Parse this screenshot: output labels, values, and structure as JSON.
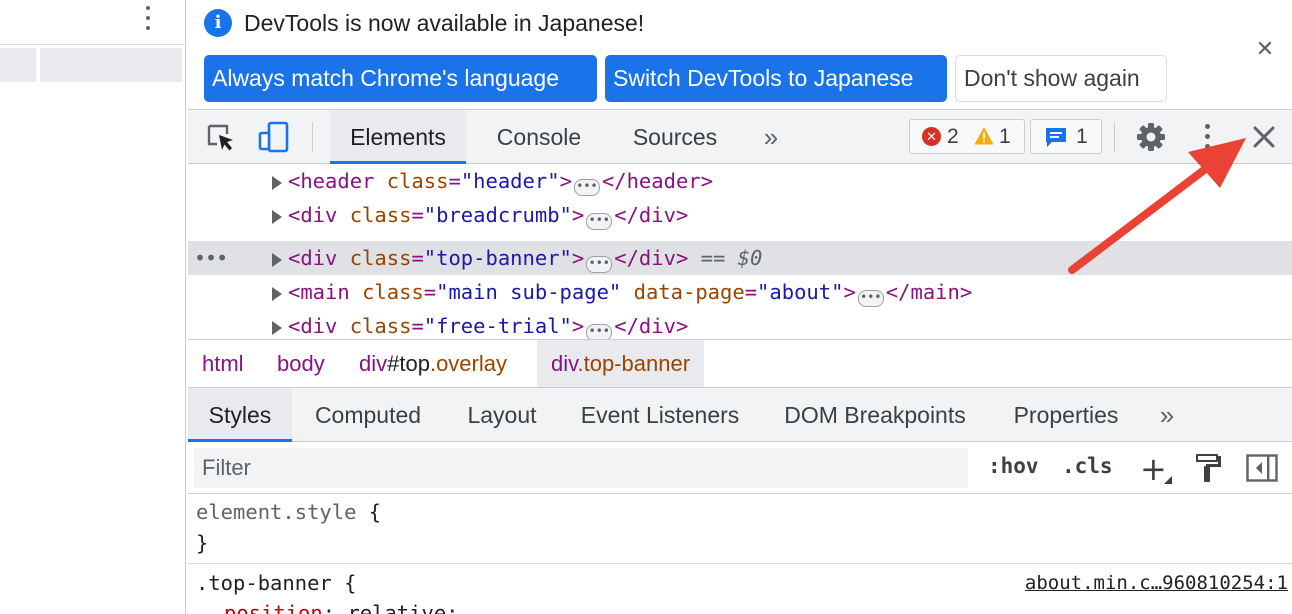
{
  "infobar": {
    "message": "DevTools is now available in Japanese!",
    "info_icon_glyph": "i",
    "always_match_label": "Always match Chrome's language",
    "switch_label": "Switch DevTools to Japanese",
    "dont_show_label": "Don't show again",
    "close_glyph": "✕"
  },
  "toolbar": {
    "tabs": [
      {
        "label": "Elements",
        "selected": true
      },
      {
        "label": "Console",
        "selected": false
      },
      {
        "label": "Sources",
        "selected": false
      }
    ],
    "more_tabs_glyph": "»",
    "error_count": "2",
    "warning_count": "1",
    "message_count": "1",
    "error_glyph": "✕"
  },
  "dom_tree": {
    "rows": [
      {
        "open_tag": "<header",
        "attr": "class",
        "value": "\"header\"",
        "close": "</header>"
      },
      {
        "open_tag": "<div",
        "attr": "class",
        "value": "\"breadcrumb\"",
        "close": "</div>"
      },
      {
        "open_tag": "<div",
        "attr": "class",
        "value": "\"top-banner\"",
        "close": "</div>",
        "selected": true,
        "suffix": "== $0"
      },
      {
        "open_tag": "<main",
        "attr": "class",
        "value": "\"main sub-page\"",
        "attr2": "data-page",
        "value2": "\"about\"",
        "close": "</main>"
      },
      {
        "open_tag": "<div",
        "attr": "class",
        "value": "\"free-trial\"",
        "close": "</div>"
      }
    ],
    "row_dots": "•••",
    "ellipsis": "•••"
  },
  "breadcrumb": {
    "items": [
      {
        "tag": "html"
      },
      {
        "tag": "body"
      },
      {
        "tag": "div",
        "id": "#top",
        "cls": ".overlay"
      },
      {
        "tag": "div",
        "cls": ".top-banner",
        "selected": true
      }
    ]
  },
  "sidebar_tabs": {
    "tabs": [
      {
        "label": "Styles",
        "selected": true
      },
      {
        "label": "Computed"
      },
      {
        "label": "Layout"
      },
      {
        "label": "Event Listeners"
      },
      {
        "label": "DOM Breakpoints"
      },
      {
        "label": "Properties"
      }
    ],
    "more_glyph": "»"
  },
  "filter_bar": {
    "placeholder": "Filter",
    "hov_label": ":hov",
    "cls_label": ".cls",
    "plus_label": "+"
  },
  "styles": {
    "element_style_selector": "element.style",
    "open_brace": "{",
    "close_brace": "}",
    "rule_selector": ".top-banner",
    "source_link": "about.min.c…960810254:1",
    "first_prop_name": "position",
    "first_prop_value": "relative;"
  },
  "colors": {
    "accent": "#1a73e8",
    "annotation_arrow": "#ea4335",
    "error": "#d93025",
    "warning": "#f9ab00"
  }
}
